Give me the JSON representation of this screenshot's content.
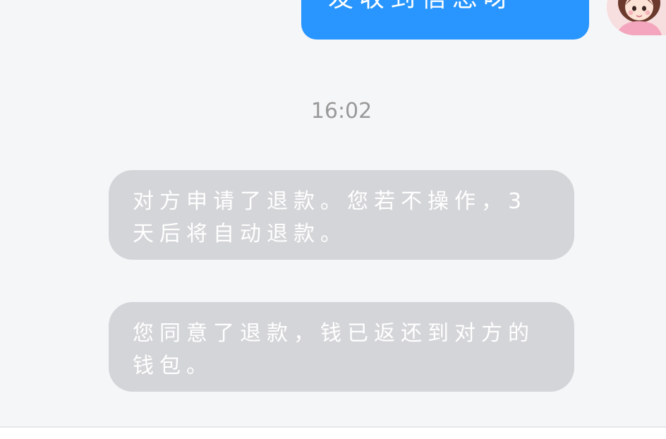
{
  "chat": {
    "sent_message": {
      "text": "发收到信息呀"
    },
    "timestamp": "16:02",
    "system_messages": [
      {
        "text": "对方申请了退款。您若不操作，3天后将自动退款。"
      },
      {
        "text": "您同意了退款，钱已返还到对方的钱包。"
      }
    ]
  },
  "colors": {
    "background": "#f5f6f8",
    "sent_bubble": "#2896fe",
    "system_bubble": "#d4d5d8",
    "timestamp_text": "#999999",
    "bubble_text": "#ffffff"
  },
  "icons": {
    "avatar": "user-avatar-doll"
  }
}
